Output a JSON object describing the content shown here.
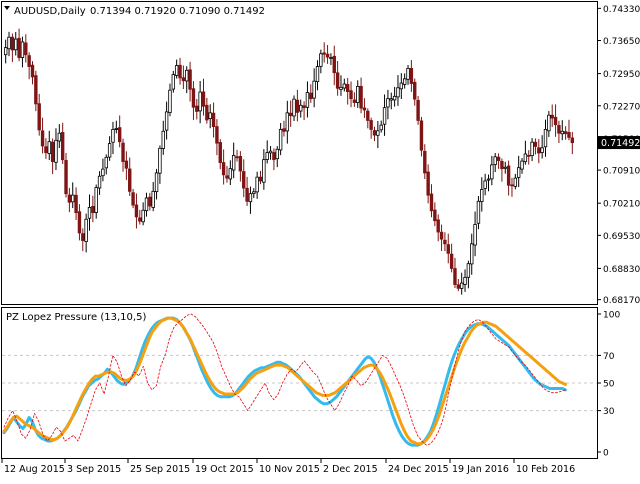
{
  "window": {
    "title": "AUDUSD,Daily",
    "ohlc": "0.71394 0.71920 0.71090 0.71492"
  },
  "price_panel": {
    "current_price_label": "0.71492",
    "y_ticks": [
      "0.74330",
      "0.73650",
      "0.72950",
      "0.72270",
      "0.71580",
      "0.70910",
      "0.70210",
      "0.69530",
      "0.68830",
      "0.68170"
    ]
  },
  "indicator_panel": {
    "title": "PZ Lopez Pressure (13,10,5)",
    "y_ticks": [
      "100",
      "70",
      "50",
      "30",
      "0"
    ],
    "levels": [
      70,
      50,
      30
    ]
  },
  "x_axis": {
    "labels": [
      "12 Aug 2015",
      "3 Sep 2015",
      "25 Sep 2015",
      "19 Oct 2015",
      "10 Nov 2015",
      "2 Dec 2015",
      "24 Dec 2015",
      "19 Jan 2016",
      "10 Feb 2016"
    ]
  },
  "colors": {
    "bull": "#000000",
    "bear": "#7f1414",
    "fast_line": "#33bbee",
    "slow_line": "#f5a010",
    "raw_line": "#e8000c",
    "grid": "#c8c8c8",
    "price_tag_bg": "#000000"
  },
  "chart_data": [
    {
      "type": "candlestick",
      "title": "AUDUSD,Daily",
      "ylim": [
        0.6812,
        0.7438
      ],
      "x_labels": [
        "12 Aug 2015",
        "3 Sep 2015",
        "25 Sep 2015",
        "19 Oct 2015",
        "10 Nov 2015",
        "2 Dec 2015",
        "24 Dec 2015",
        "19 Jan 2016",
        "10 Feb 2016"
      ],
      "close": [
        0.735,
        0.7372,
        0.7345,
        0.7368,
        0.7329,
        0.7362,
        0.7335,
        0.731,
        0.7288,
        0.7231,
        0.7176,
        0.7142,
        0.7128,
        0.7151,
        0.7109,
        0.7154,
        0.7169,
        0.7113,
        0.7041,
        0.7023,
        0.7038,
        0.7001,
        0.6958,
        0.6942,
        0.6987,
        0.7012,
        0.7001,
        0.7054,
        0.7078,
        0.7093,
        0.7118,
        0.7147,
        0.7177,
        0.7179,
        0.7151,
        0.7109,
        0.7095,
        0.7046,
        0.7017,
        0.6992,
        0.6983,
        0.7006,
        0.7032,
        0.7015,
        0.7046,
        0.7085,
        0.7137,
        0.7173,
        0.7214,
        0.726,
        0.7293,
        0.7312,
        0.7286,
        0.728,
        0.7302,
        0.7262,
        0.7224,
        0.7215,
        0.7256,
        0.7226,
        0.7197,
        0.7212,
        0.7183,
        0.7148,
        0.7107,
        0.7081,
        0.7074,
        0.7094,
        0.7122,
        0.7119,
        0.7089,
        0.7053,
        0.7025,
        0.7041,
        0.7045,
        0.7076,
        0.7068,
        0.7113,
        0.7128,
        0.7131,
        0.7113,
        0.7135,
        0.7177,
        0.7173,
        0.7212,
        0.7206,
        0.7241,
        0.7213,
        0.7228,
        0.7223,
        0.7255,
        0.7242,
        0.7279,
        0.731,
        0.7337,
        0.7336,
        0.733,
        0.7329,
        0.7297,
        0.7264,
        0.7266,
        0.7273,
        0.7257,
        0.7242,
        0.7234,
        0.7268,
        0.7222,
        0.7218,
        0.7196,
        0.7177,
        0.7165,
        0.7174,
        0.7186,
        0.7223,
        0.7242,
        0.7242,
        0.7247,
        0.7265,
        0.7275,
        0.7284,
        0.7306,
        0.7274,
        0.7241,
        0.7196,
        0.7133,
        0.7085,
        0.7038,
        0.7005,
        0.6984,
        0.696,
        0.6945,
        0.6935,
        0.6915,
        0.6883,
        0.6849,
        0.6841,
        0.6852,
        0.6864,
        0.6893,
        0.6935,
        0.6976,
        0.7025,
        0.705,
        0.7068,
        0.7072,
        0.7102,
        0.7119,
        0.7111,
        0.7094,
        0.7097,
        0.7059,
        0.7059,
        0.7074,
        0.7096,
        0.711,
        0.7125,
        0.7121,
        0.715,
        0.7141,
        0.7127,
        0.7138,
        0.7177,
        0.7207,
        0.7201,
        0.7187,
        0.7169,
        0.7173,
        0.7168,
        0.716,
        0.7149
      ]
    },
    {
      "type": "line",
      "title": "PZ Lopez Pressure (13,10,5)",
      "ylim": [
        0,
        100
      ],
      "reference_levels": [
        70,
        50,
        30
      ],
      "series": [
        {
          "values": [
            14,
            17,
            21,
            25,
            22,
            19,
            17,
            20,
            25,
            22,
            16,
            12,
            10,
            9,
            8,
            8,
            9,
            10,
            12,
            15,
            18,
            22,
            26,
            30,
            35,
            40,
            44,
            48,
            50,
            52,
            53,
            55,
            57,
            60,
            58,
            55,
            52,
            50,
            49,
            50,
            52,
            55,
            60,
            67,
            74,
            80,
            85,
            89,
            92,
            94,
            95,
            96,
            97,
            97,
            97,
            96,
            94,
            91,
            87,
            83,
            78,
            72,
            66,
            60,
            55,
            50,
            46,
            43,
            41,
            40,
            40,
            40,
            40,
            41,
            43,
            46,
            49,
            52,
            55,
            57,
            59,
            60,
            61,
            61,
            62,
            63,
            64,
            65,
            65,
            64,
            63,
            61,
            59,
            57,
            55,
            52,
            49,
            46,
            43,
            40,
            38,
            36,
            35,
            35,
            36,
            38,
            40,
            43,
            46,
            49,
            52,
            55,
            58,
            61,
            64,
            67,
            69,
            68,
            65,
            60,
            54,
            47,
            40,
            33,
            26,
            20,
            15,
            11,
            8,
            6,
            5,
            5,
            5,
            6,
            8,
            11,
            15,
            21,
            28,
            36,
            44,
            52,
            60,
            67,
            73,
            78,
            82,
            86,
            89,
            91,
            92,
            93,
            93,
            92,
            91,
            89,
            87,
            85,
            83,
            81,
            79,
            77,
            74,
            71,
            68,
            65,
            62,
            59,
            56,
            53,
            51,
            49,
            48,
            47,
            46,
            46,
            46,
            46,
            46,
            45
          ]
        },
        {
          "values": [
            15,
            18,
            22,
            25,
            26,
            24,
            22,
            20,
            19,
            18,
            16,
            14,
            12,
            11,
            10,
            9,
            9,
            10,
            12,
            15,
            18,
            22,
            27,
            32,
            37,
            42,
            46,
            50,
            53,
            55,
            55,
            56,
            57,
            58,
            58,
            57,
            55,
            53,
            52,
            52,
            53,
            55,
            59,
            64,
            70,
            76,
            82,
            87,
            90,
            93,
            95,
            96,
            97,
            97,
            96,
            95,
            93,
            90,
            86,
            82,
            77,
            72,
            67,
            62,
            57,
            53,
            49,
            46,
            44,
            43,
            42,
            42,
            42,
            42,
            43,
            45,
            47,
            50,
            53,
            55,
            57,
            58,
            59,
            60,
            61,
            62,
            63,
            63,
            63,
            62,
            61,
            59,
            57,
            55,
            53,
            51,
            49,
            47,
            45,
            43,
            42,
            41,
            41,
            41,
            42,
            43,
            45,
            47,
            49,
            51,
            53,
            55,
            57,
            59,
            61,
            62,
            63,
            63,
            61,
            58,
            54,
            49,
            44,
            38,
            32,
            26,
            20,
            15,
            11,
            8,
            7,
            6,
            6,
            7,
            9,
            12,
            16,
            21,
            27,
            34,
            41,
            48,
            55,
            62,
            68,
            74,
            79,
            83,
            87,
            90,
            92,
            93,
            94,
            94,
            93,
            92,
            91,
            89,
            87,
            85,
            83,
            81,
            79,
            77,
            75,
            73,
            71,
            69,
            67,
            65,
            63,
            61,
            59,
            57,
            55,
            53,
            51,
            50,
            49
          ]
        },
        {
          "values": [
            18,
            25,
            30,
            22,
            13,
            10,
            16,
            28,
            22,
            12,
            8,
            12,
            18,
            15,
            8,
            10,
            12,
            8,
            16,
            25,
            35,
            45,
            50,
            42,
            55,
            70,
            65,
            55,
            48,
            52,
            58,
            55,
            62,
            50,
            45,
            48,
            62,
            70,
            82,
            90,
            94,
            96,
            99,
            100,
            98,
            94,
            90,
            85,
            80,
            72,
            62,
            55,
            48,
            42,
            40,
            35,
            30,
            35,
            40,
            45,
            50,
            42,
            38,
            42,
            50,
            56,
            60,
            58,
            62,
            66,
            62,
            58,
            55,
            48,
            40,
            35,
            30,
            35,
            42,
            48,
            55,
            52,
            48,
            50,
            55,
            60,
            65,
            70,
            68,
            62,
            55,
            48,
            40,
            30,
            20,
            12,
            8,
            5,
            6,
            10,
            16,
            25,
            40,
            55,
            68,
            80,
            88,
            92,
            95,
            96,
            94,
            90,
            86,
            82,
            80,
            78,
            76,
            72,
            68,
            65,
            62,
            58,
            54,
            50,
            46,
            44,
            43,
            43,
            44,
            45
          ]
        }
      ]
    }
  ]
}
